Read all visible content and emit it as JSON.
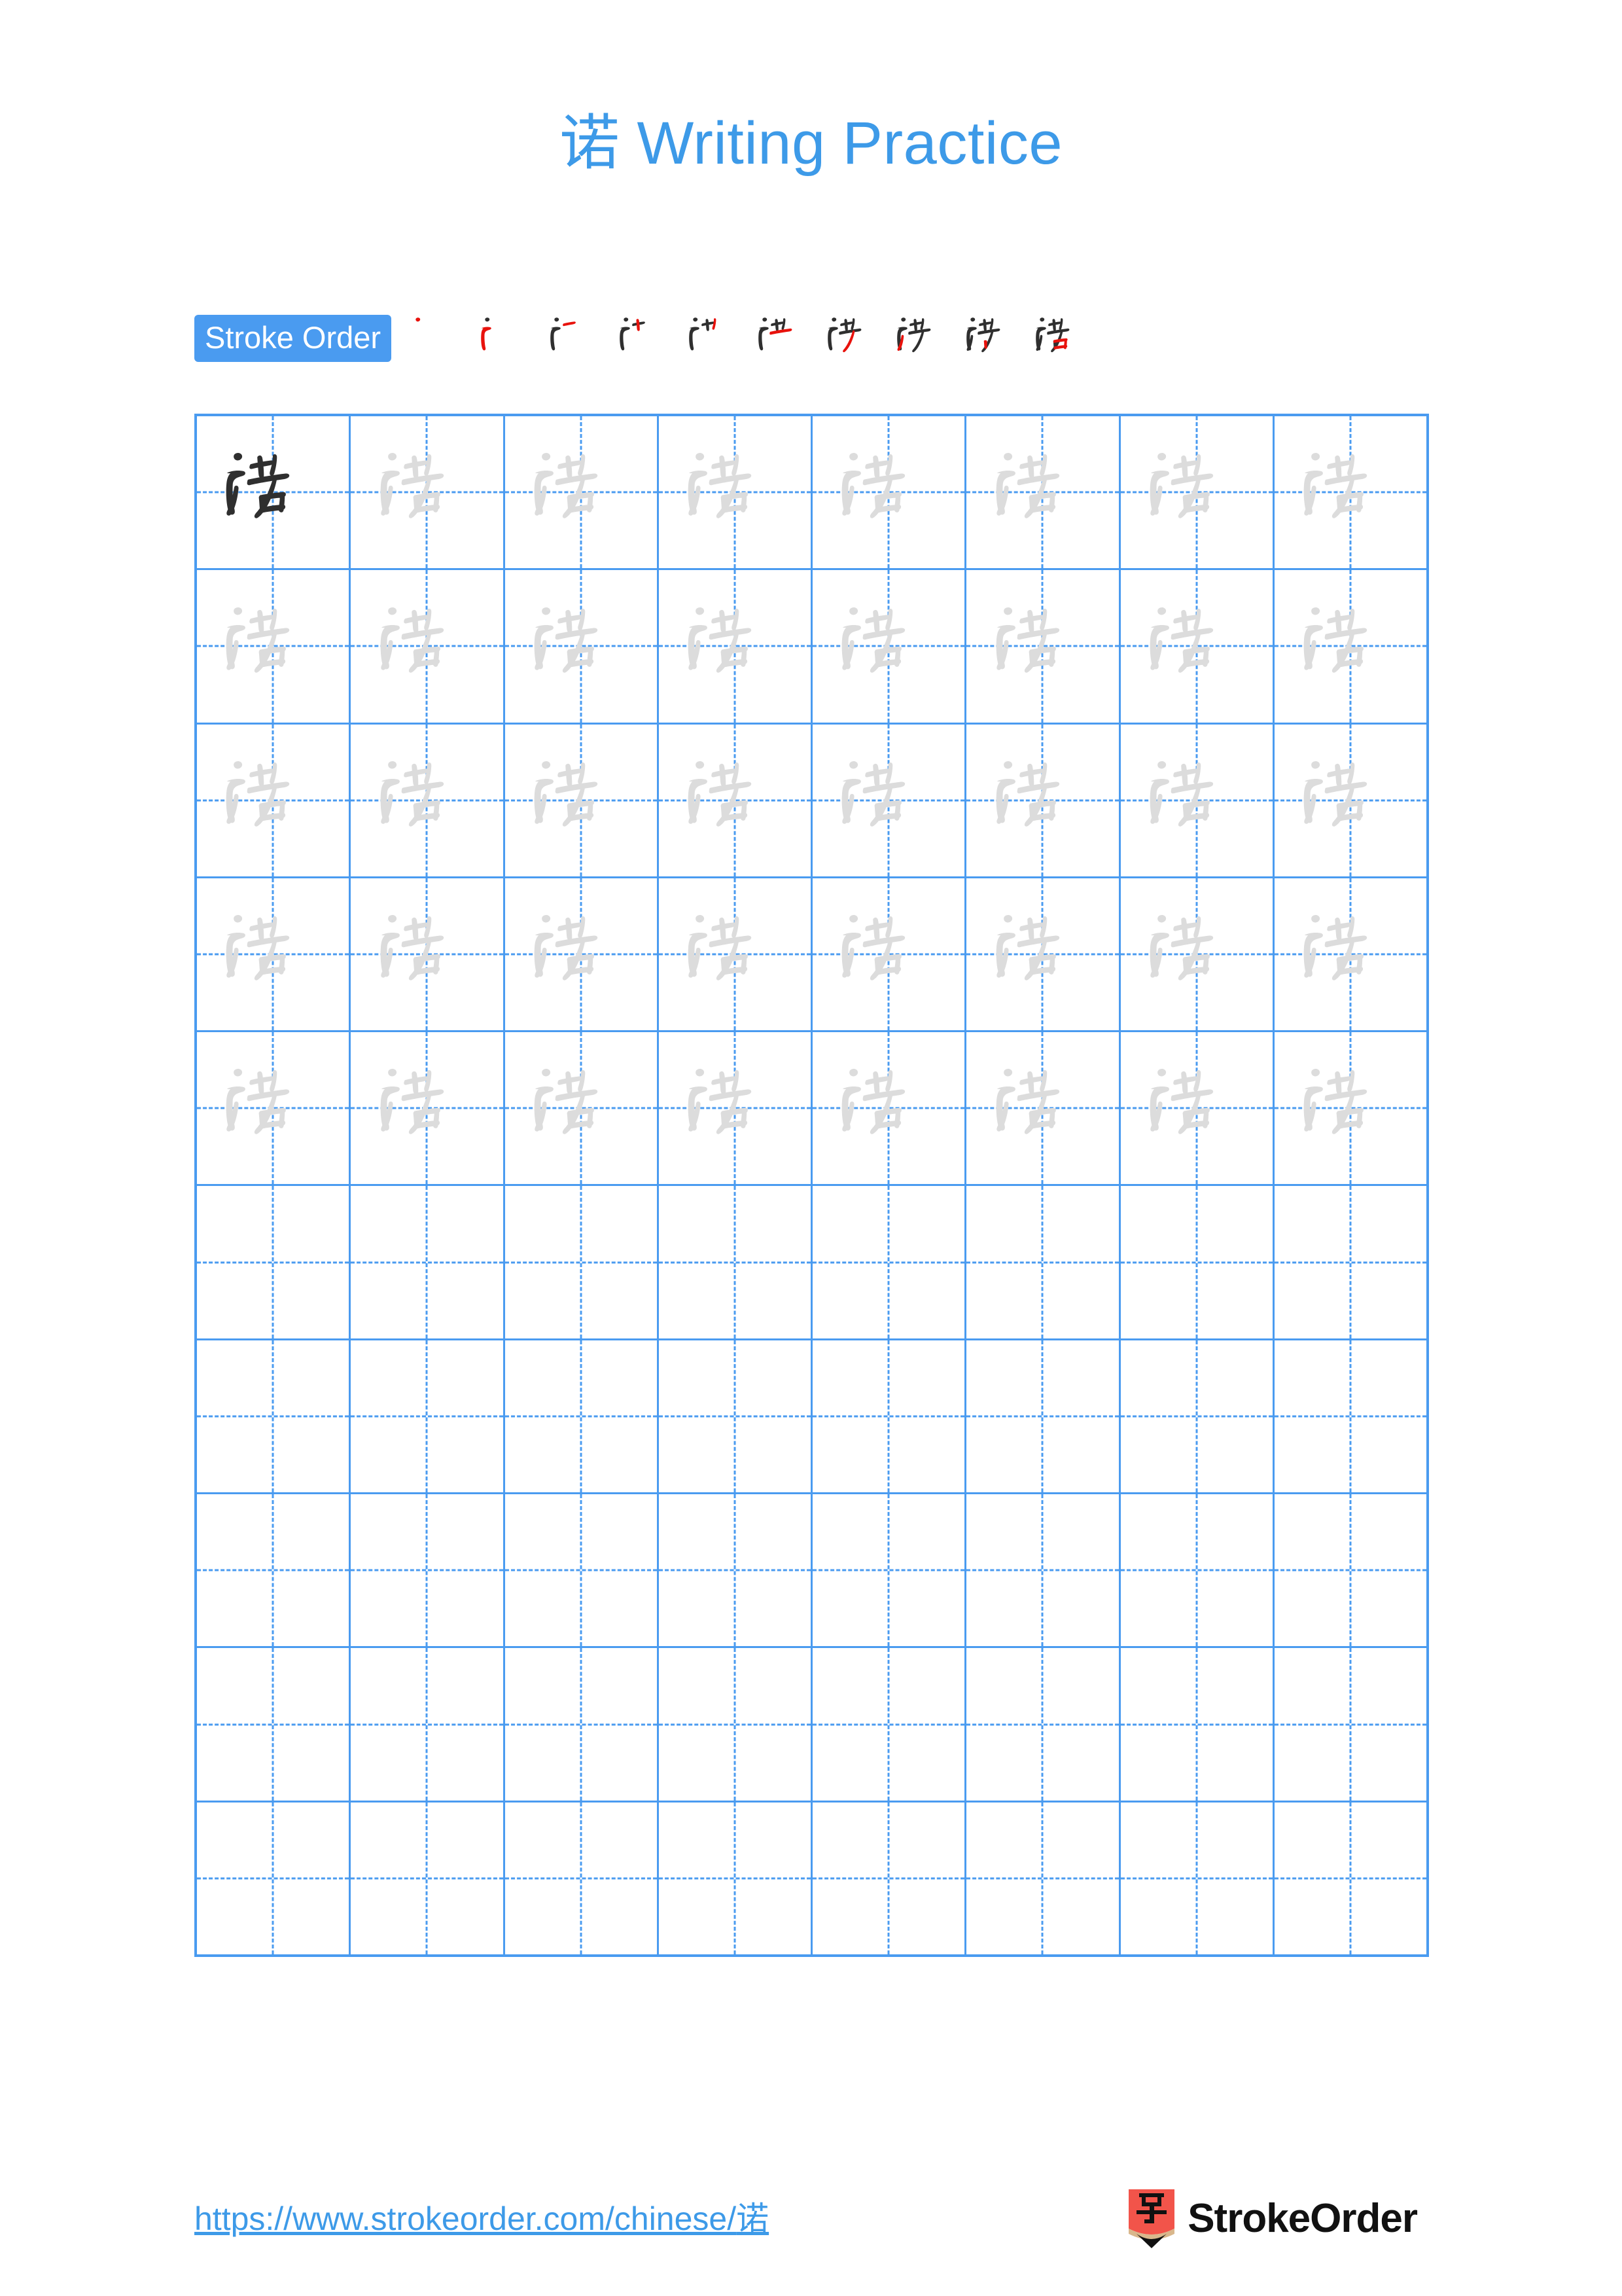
{
  "page": {
    "character": "诺",
    "title": "诺 Writing Practice",
    "title_character": "诺",
    "title_text": " Writing Practice",
    "background_color": "#ffffff",
    "accent_color": "#3d9ae8",
    "grid_line_color": "#4a9bf0",
    "stroke_new_color": "#e8120c",
    "stroke_done_color": "#2f2f2f",
    "trace_color": "#dcdcdc"
  },
  "stroke_order": {
    "label": "Stroke Order",
    "badge_background": "#4a9bf0",
    "badge_text_color": "#ffffff",
    "total_strokes": 10,
    "steps": [
      {
        "index": 1,
        "strokes_shown": 1,
        "new_stroke": 1
      },
      {
        "index": 2,
        "strokes_shown": 2,
        "new_stroke": 2
      },
      {
        "index": 3,
        "strokes_shown": 3,
        "new_stroke": 3
      },
      {
        "index": 4,
        "strokes_shown": 4,
        "new_stroke": 4
      },
      {
        "index": 5,
        "strokes_shown": 5,
        "new_stroke": 5
      },
      {
        "index": 6,
        "strokes_shown": 6,
        "new_stroke": 6
      },
      {
        "index": 7,
        "strokes_shown": 7,
        "new_stroke": 7
      },
      {
        "index": 8,
        "strokes_shown": 8,
        "new_stroke": 8
      },
      {
        "index": 9,
        "strokes_shown": 9,
        "new_stroke": 9
      },
      {
        "index": 10,
        "strokes_shown": 10,
        "new_stroke": 10
      }
    ]
  },
  "practice_grid": {
    "columns": 8,
    "rows": 10,
    "guide_style": "dashed-cross",
    "rows_data": [
      {
        "row": 1,
        "cells": [
          "dark",
          "light",
          "light",
          "light",
          "light",
          "light",
          "light",
          "light"
        ]
      },
      {
        "row": 2,
        "cells": [
          "light",
          "light",
          "light",
          "light",
          "light",
          "light",
          "light",
          "light"
        ]
      },
      {
        "row": 3,
        "cells": [
          "light",
          "light",
          "light",
          "light",
          "light",
          "light",
          "light",
          "light"
        ]
      },
      {
        "row": 4,
        "cells": [
          "light",
          "light",
          "light",
          "light",
          "light",
          "light",
          "light",
          "light"
        ]
      },
      {
        "row": 5,
        "cells": [
          "light",
          "light",
          "light",
          "light",
          "light",
          "light",
          "light",
          "light"
        ]
      },
      {
        "row": 6,
        "cells": [
          "empty",
          "empty",
          "empty",
          "empty",
          "empty",
          "empty",
          "empty",
          "empty"
        ]
      },
      {
        "row": 7,
        "cells": [
          "empty",
          "empty",
          "empty",
          "empty",
          "empty",
          "empty",
          "empty",
          "empty"
        ]
      },
      {
        "row": 8,
        "cells": [
          "empty",
          "empty",
          "empty",
          "empty",
          "empty",
          "empty",
          "empty",
          "empty"
        ]
      },
      {
        "row": 9,
        "cells": [
          "empty",
          "empty",
          "empty",
          "empty",
          "empty",
          "empty",
          "empty",
          "empty"
        ]
      },
      {
        "row": 10,
        "cells": [
          "empty",
          "empty",
          "empty",
          "empty",
          "empty",
          "empty",
          "empty",
          "empty"
        ]
      }
    ]
  },
  "footer": {
    "url": "https://www.strokeorder.com/chinese/诺",
    "url_prefix": "https://www.strokeorder.com/chinese/",
    "url_character": "诺",
    "brand_name": "StrokeOrder",
    "logo_icon": "pencil-zi-icon",
    "logo_character": "字",
    "logo_body_color": "#f2544a",
    "logo_wood_color": "#d9b78c",
    "logo_tip_color": "#111111"
  }
}
